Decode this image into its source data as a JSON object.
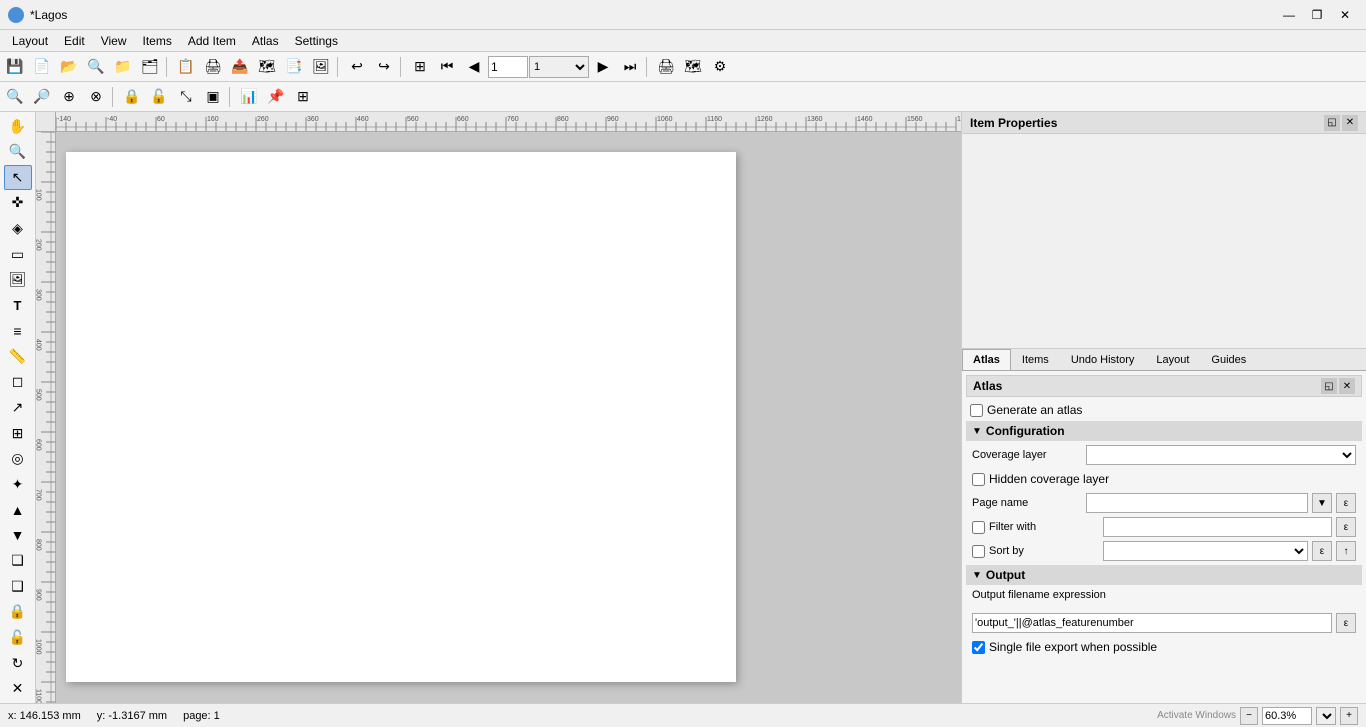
{
  "titlebar": {
    "title": "*Lagos",
    "minimize": "—",
    "maximize": "❐",
    "close": "✕"
  },
  "menubar": {
    "items": [
      "Layout",
      "Edit",
      "View",
      "Items",
      "Add Item",
      "Atlas",
      "Settings"
    ]
  },
  "toolbar1": {
    "buttons": [
      {
        "name": "save",
        "icon": "💾",
        "tooltip": "Save"
      },
      {
        "name": "new",
        "icon": "📄",
        "tooltip": "New"
      },
      {
        "name": "open",
        "icon": "📂",
        "tooltip": "Open"
      },
      {
        "name": "find",
        "icon": "🔍",
        "tooltip": "Find"
      },
      {
        "name": "open-folder",
        "icon": "📁",
        "tooltip": "Open Folder"
      },
      {
        "name": "save-as",
        "icon": "💾",
        "tooltip": "Save As"
      },
      {
        "name": "new2",
        "icon": "📋",
        "tooltip": "New"
      },
      {
        "name": "print",
        "icon": "🖨",
        "tooltip": "Print"
      },
      {
        "name": "export-all",
        "icon": "📤",
        "tooltip": "Export All"
      },
      {
        "name": "export-atlas",
        "icon": "🗺",
        "tooltip": "Export Atlas"
      },
      {
        "name": "export-pdf",
        "icon": "📑",
        "tooltip": "Export PDF"
      },
      {
        "name": "export-svg",
        "icon": "🖼",
        "tooltip": "Export SVG"
      },
      {
        "name": "undo",
        "icon": "↩",
        "tooltip": "Undo"
      },
      {
        "name": "redo",
        "icon": "↪",
        "tooltip": "Redo"
      },
      {
        "name": "zoom-full",
        "icon": "⊞",
        "tooltip": "Zoom Full"
      },
      {
        "name": "prev-page",
        "icon": "⏮",
        "tooltip": "Previous Page"
      },
      {
        "name": "prev",
        "icon": "◀",
        "tooltip": "Previous"
      },
      {
        "name": "page-input",
        "value": "1"
      },
      {
        "name": "next",
        "icon": "▶",
        "tooltip": "Next"
      },
      {
        "name": "next-page",
        "icon": "⏭",
        "tooltip": "Next Page"
      },
      {
        "name": "print2",
        "icon": "🖨",
        "tooltip": "Print"
      },
      {
        "name": "atlas-preview",
        "icon": "🗺",
        "tooltip": "Atlas Preview"
      },
      {
        "name": "atlas-settings",
        "icon": "⚙",
        "tooltip": "Atlas Settings"
      }
    ]
  },
  "toolbar2": {
    "buttons": [
      {
        "name": "zoom-in",
        "icon": "🔍+",
        "tooltip": "Zoom In"
      },
      {
        "name": "zoom-out",
        "icon": "🔍-",
        "tooltip": "Zoom Out"
      },
      {
        "name": "zoom-select",
        "icon": "🔎",
        "tooltip": "Zoom to Selection"
      },
      {
        "name": "pan",
        "icon": "✋",
        "tooltip": "Pan"
      },
      {
        "name": "lock",
        "icon": "🔒",
        "tooltip": "Lock"
      },
      {
        "name": "unlock",
        "icon": "🔓",
        "tooltip": "Unlock"
      },
      {
        "name": "zoom-region",
        "icon": "🔍",
        "tooltip": "Zoom Region"
      },
      {
        "name": "zoom-layer",
        "icon": "🔍",
        "tooltip": "Zoom Layer"
      },
      {
        "name": "resize",
        "icon": "⤡",
        "tooltip": "Resize"
      },
      {
        "name": "align",
        "icon": "▣",
        "tooltip": "Align"
      },
      {
        "name": "chart",
        "icon": "📊",
        "tooltip": "Chart"
      },
      {
        "name": "atlas-features",
        "icon": "📌",
        "tooltip": "Atlas Features"
      }
    ]
  },
  "left_tools": [
    {
      "name": "pan-tool",
      "icon": "✋"
    },
    {
      "name": "zoom-tool",
      "icon": "🔍"
    },
    {
      "name": "select-tool",
      "icon": "↖",
      "active": true
    },
    {
      "name": "move-tool",
      "icon": "✜"
    },
    {
      "name": "node-tool",
      "icon": "◈"
    },
    {
      "name": "add-map",
      "icon": "▭"
    },
    {
      "name": "add-picture",
      "icon": "🖼"
    },
    {
      "name": "add-label",
      "icon": "T"
    },
    {
      "name": "add-legend",
      "icon": "≡"
    },
    {
      "name": "add-scalebar",
      "icon": "📏"
    },
    {
      "name": "add-shape",
      "icon": "◻"
    },
    {
      "name": "add-arrow",
      "icon": "↗"
    },
    {
      "name": "add-table",
      "icon": "⊞"
    },
    {
      "name": "add-html",
      "icon": "◎"
    },
    {
      "name": "add-marker",
      "icon": "✦"
    },
    {
      "name": "raise-item",
      "icon": "▲"
    },
    {
      "name": "lower-item",
      "icon": "▼"
    },
    {
      "name": "group",
      "icon": "❏"
    },
    {
      "name": "ungroup",
      "icon": "❑"
    },
    {
      "name": "lock-items",
      "icon": "🔒"
    },
    {
      "name": "unlock-items",
      "icon": "🔓"
    },
    {
      "name": "rotate",
      "icon": "↻"
    },
    {
      "name": "delete-guide",
      "icon": "✕"
    }
  ],
  "canvas": {
    "ruler_origin": -140,
    "zoom": "60.3%",
    "page": "1"
  },
  "right_panel": {
    "item_properties_title": "Item Properties",
    "tabs": [
      "Atlas",
      "Items",
      "Undo History",
      "Layout",
      "Guides"
    ],
    "active_tab": "Atlas"
  },
  "atlas_panel": {
    "title": "Atlas",
    "generate_atlas_label": "Generate an atlas",
    "generate_atlas_checked": false,
    "sections": {
      "configuration": {
        "label": "Configuration",
        "fields": {
          "coverage_layer": {
            "label": "Coverage layer",
            "value": "",
            "options": []
          },
          "hidden_coverage": {
            "label": "Hidden coverage layer",
            "checked": false
          },
          "page_name": {
            "label": "Page name",
            "value": ""
          },
          "filter_with": {
            "label": "Filter with",
            "checked": false,
            "value": ""
          },
          "sort_by": {
            "label": "Sort by",
            "checked": false,
            "value": ""
          }
        }
      },
      "output": {
        "label": "Output",
        "filename_label": "Output filename expression",
        "filename_value": "'output_'||@atlas_featurenumber",
        "single_file_label": "Single file export when possible",
        "single_file_checked": true
      }
    }
  },
  "statusbar": {
    "x_label": "x: 146.153 mm",
    "y_label": "y: -1.3167 mm",
    "page_label": "page: 1",
    "zoom_value": "60.3%",
    "zoom_label": "60.3%"
  }
}
